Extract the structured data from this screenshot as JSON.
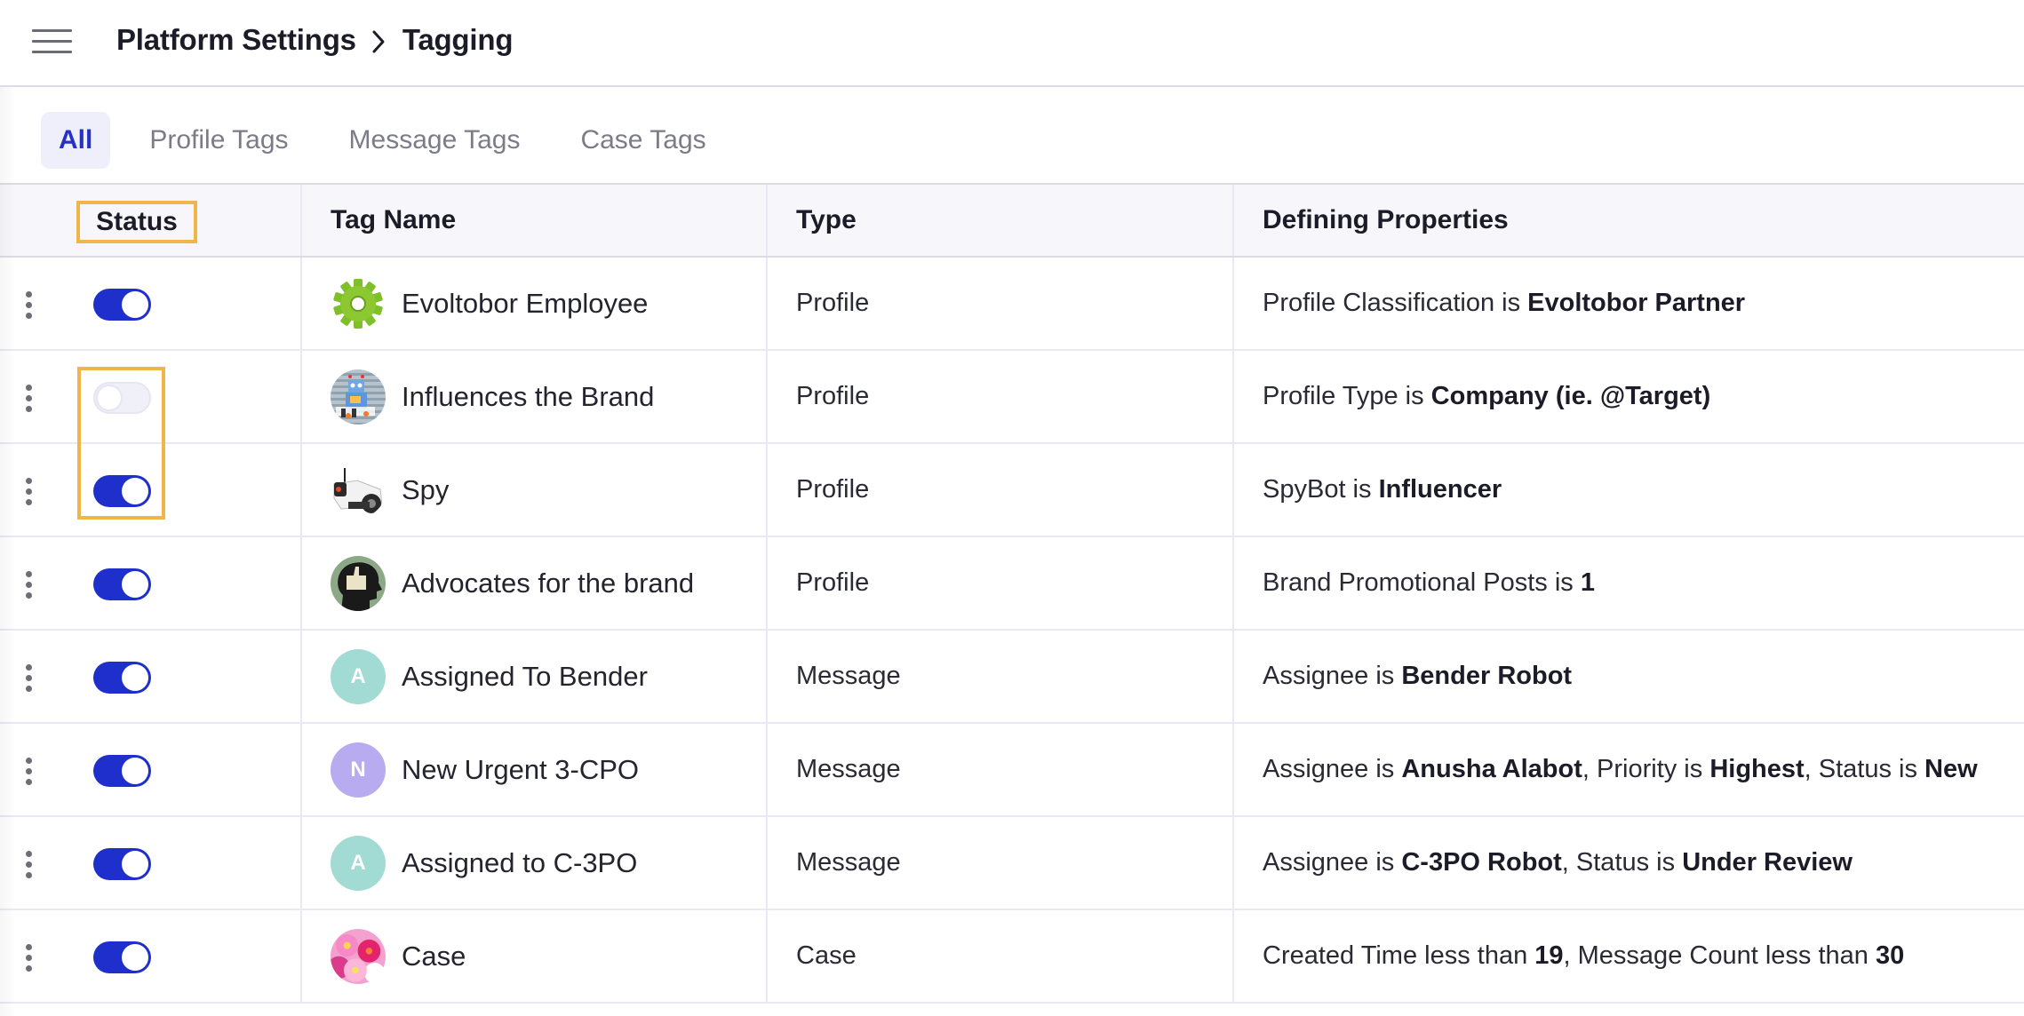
{
  "header": {
    "menu_icon": "hamburger-menu-icon",
    "breadcrumb": [
      "Platform Settings",
      "Tagging"
    ],
    "separator_icon": "chevron-right-icon"
  },
  "tabs": [
    {
      "label": "All",
      "active": true
    },
    {
      "label": "Profile Tags",
      "active": false
    },
    {
      "label": "Message Tags",
      "active": false
    },
    {
      "label": "Case Tags",
      "active": false
    }
  ],
  "table": {
    "columns": [
      "Status",
      "Tag Name",
      "Type",
      "Defining Properties"
    ],
    "rows": [
      {
        "enabled": true,
        "avatar": {
          "kind": "image",
          "icon": "green-gear-icon"
        },
        "name": "Evoltobor Employee",
        "type": "Profile",
        "props": [
          {
            "text": "Profile Classification is ",
            "bold": false
          },
          {
            "text": "Evoltobor Partner",
            "bold": true
          }
        ]
      },
      {
        "enabled": false,
        "avatar": {
          "kind": "image",
          "icon": "toy-robot-icon"
        },
        "name": "Influences the Brand",
        "type": "Profile",
        "props": [
          {
            "text": "Profile Type is ",
            "bold": false
          },
          {
            "text": "Company (ie. @Target)",
            "bold": true
          }
        ]
      },
      {
        "enabled": true,
        "avatar": {
          "kind": "image",
          "icon": "spy-robot-icon"
        },
        "name": "Spy",
        "type": "Profile",
        "props": [
          {
            "text": "SpyBot is ",
            "bold": false
          },
          {
            "text": "Influencer",
            "bold": true
          }
        ]
      },
      {
        "enabled": true,
        "avatar": {
          "kind": "image",
          "icon": "thumbs-up-head-icon"
        },
        "name": "Advocates for the brand",
        "type": "Profile",
        "props": [
          {
            "text": "Brand Promotional Posts is ",
            "bold": false
          },
          {
            "text": "1",
            "bold": true
          }
        ]
      },
      {
        "enabled": true,
        "avatar": {
          "kind": "initial",
          "initial": "A",
          "color": "#a2dbd4"
        },
        "name": "Assigned To Bender",
        "type": "Message",
        "props": [
          {
            "text": "Assignee is ",
            "bold": false
          },
          {
            "text": "Bender Robot",
            "bold": true
          }
        ]
      },
      {
        "enabled": true,
        "avatar": {
          "kind": "initial",
          "initial": "N",
          "color": "#b9abf0"
        },
        "name": "New Urgent 3-CPO",
        "type": "Message",
        "props": [
          {
            "text": "Assignee is ",
            "bold": false
          },
          {
            "text": "Anusha Alabot",
            "bold": true
          },
          {
            "text": ", Priority is ",
            "bold": false
          },
          {
            "text": "Highest",
            "bold": true
          },
          {
            "text": ", Status is ",
            "bold": false
          },
          {
            "text": "New",
            "bold": true
          }
        ]
      },
      {
        "enabled": true,
        "avatar": {
          "kind": "initial",
          "initial": "A",
          "color": "#a2dbd4"
        },
        "name": "Assigned to C-3PO",
        "type": "Message",
        "props": [
          {
            "text": "Assignee is ",
            "bold": false
          },
          {
            "text": "C-3PO Robot",
            "bold": true
          },
          {
            "text": ", Status is ",
            "bold": false
          },
          {
            "text": "Under Review",
            "bold": true
          }
        ]
      },
      {
        "enabled": true,
        "avatar": {
          "kind": "image",
          "icon": "flowers-icon"
        },
        "name": "Case",
        "type": "Case",
        "props": [
          {
            "text": "Created Time less than ",
            "bold": false
          },
          {
            "text": "19",
            "bold": true
          },
          {
            "text": ", Message Count less than ",
            "bold": false
          },
          {
            "text": "30",
            "bold": true
          }
        ]
      }
    ]
  },
  "colors": {
    "accent": "#1f2fcc",
    "highlight": "#f0b64a",
    "active_tab_bg": "#eeeffb"
  }
}
